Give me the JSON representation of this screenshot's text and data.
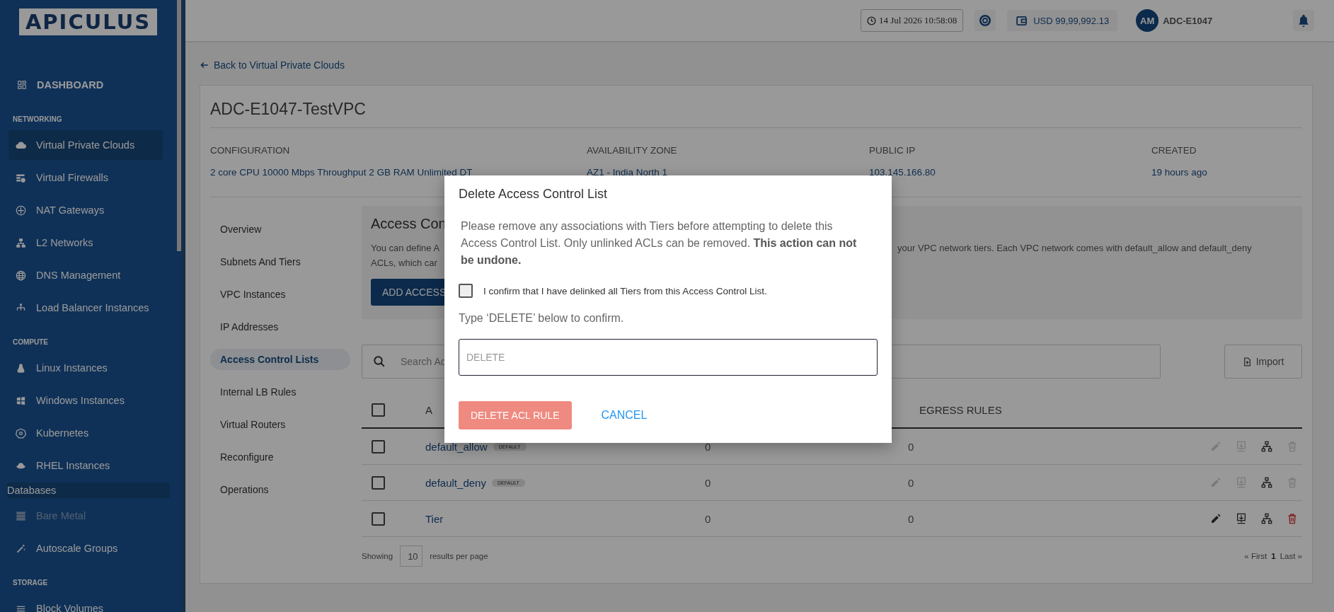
{
  "logo": {
    "text": "APICULUS"
  },
  "header": {
    "datetime": "14 Jul 2026 10:58:08",
    "balance": "USD 99,99,992.13",
    "avatar": "AM",
    "account": "ADC-E1047"
  },
  "sidebar": {
    "dashboard": "DASHBOARD",
    "items": [
      {
        "kind": "section",
        "label": "NETWORKING"
      },
      {
        "kind": "item",
        "label": "Virtual Private Clouds",
        "selected": true,
        "disabled": false
      },
      {
        "kind": "item",
        "label": "Virtual Firewalls",
        "selected": false,
        "disabled": false
      },
      {
        "kind": "item",
        "label": "NAT Gateways",
        "selected": false,
        "disabled": false
      },
      {
        "kind": "item",
        "label": "L2 Networks",
        "selected": false,
        "disabled": false
      },
      {
        "kind": "item",
        "label": "DNS Management",
        "selected": false,
        "disabled": false
      },
      {
        "kind": "item",
        "label": "Load Balancer Instances",
        "selected": false,
        "disabled": false
      },
      {
        "kind": "section",
        "label": "COMPUTE"
      },
      {
        "kind": "item",
        "label": "Linux Instances",
        "selected": false,
        "disabled": false
      },
      {
        "kind": "item",
        "label": "Windows Instances",
        "selected": false,
        "disabled": false
      },
      {
        "kind": "item",
        "label": "Kubernetes",
        "selected": false,
        "disabled": false
      },
      {
        "kind": "item",
        "label": "RHEL Instances",
        "selected": false,
        "disabled": false
      },
      {
        "kind": "plain",
        "label": "Databases",
        "selected": true,
        "disabled": false
      },
      {
        "kind": "item",
        "label": "Bare Metal",
        "selected": false,
        "disabled": true
      },
      {
        "kind": "item",
        "label": "Autoscale Groups",
        "selected": false,
        "disabled": false
      },
      {
        "kind": "section",
        "label": "STORAGE"
      },
      {
        "kind": "item",
        "label": "Block Volumes",
        "selected": false,
        "disabled": false
      }
    ]
  },
  "back_link": "Back to Virtual Private Clouds",
  "vpc": {
    "title": "ADC-E1047-TestVPC",
    "details": [
      {
        "label": "CONFIGURATION",
        "value": "2 core CPU 10000 Mbps Throughput 2 GB RAM Unlimited DT"
      },
      {
        "label": "AVAILABILITY ZONE",
        "value": "AZ1 - India North 1"
      },
      {
        "label": "PUBLIC IP",
        "value": "103.145.166.80"
      },
      {
        "label": "CREATED",
        "value": "19 hours ago"
      }
    ]
  },
  "tabs": [
    {
      "label": "Overview",
      "selected": false
    },
    {
      "label": "Subnets And Tiers",
      "selected": false
    },
    {
      "label": "VPC Instances",
      "selected": false
    },
    {
      "label": "IP Addresses",
      "selected": false
    },
    {
      "label": "Access Control Lists",
      "selected": true
    },
    {
      "label": "Internal LB Rules",
      "selected": false
    },
    {
      "label": "Virtual Routers",
      "selected": false
    },
    {
      "label": "Reconfigure",
      "selected": false
    },
    {
      "label": "Operations",
      "selected": false
    }
  ],
  "info_panel": {
    "heading": "Access Con",
    "text_left_1": "You can define A",
    "text_right_1": "your VPC network tiers. Each VPC network comes with default_allow and default_deny",
    "text_left_2": "ACLs, which car",
    "button": "ADD ACCESS"
  },
  "search": {
    "placeholder": "Search Ac"
  },
  "import_button": "Import",
  "table": {
    "columns": [
      "A",
      "EGRESS RULES"
    ],
    "header_checked": false,
    "rows": [
      {
        "name": "default_allow",
        "badge": "DEFAULT",
        "ingress": "0",
        "egress": "0",
        "checked": false,
        "editable": false
      },
      {
        "name": "default_deny",
        "badge": "DEFAULT",
        "ingress": "0",
        "egress": "0",
        "checked": false,
        "editable": false
      },
      {
        "name": "Tier",
        "ingress": "0",
        "egress": "0",
        "checked": false,
        "editable": true
      }
    ]
  },
  "pagination": {
    "showing": "Showing",
    "page_size": "10",
    "per_page": "results per page",
    "first": "« First",
    "current": "1",
    "last": "Last »"
  },
  "modal": {
    "title": "Delete Access Control List",
    "message": "Please remove any associations with Tiers before attempting to delete this Access Control List. Only unlinked ACLs can be removed. **This action can not be undone.**",
    "confirm_label": "I confirm that I have delinked all Tiers from this Access Control List.",
    "confirm_checked": false,
    "type_hint": "Type ‘DELETE’ below to confirm.",
    "input_placeholder": "DELETE",
    "delete_button": "DELETE ACL RULE",
    "delete_disabled": true,
    "cancel_button": "CANCEL"
  }
}
